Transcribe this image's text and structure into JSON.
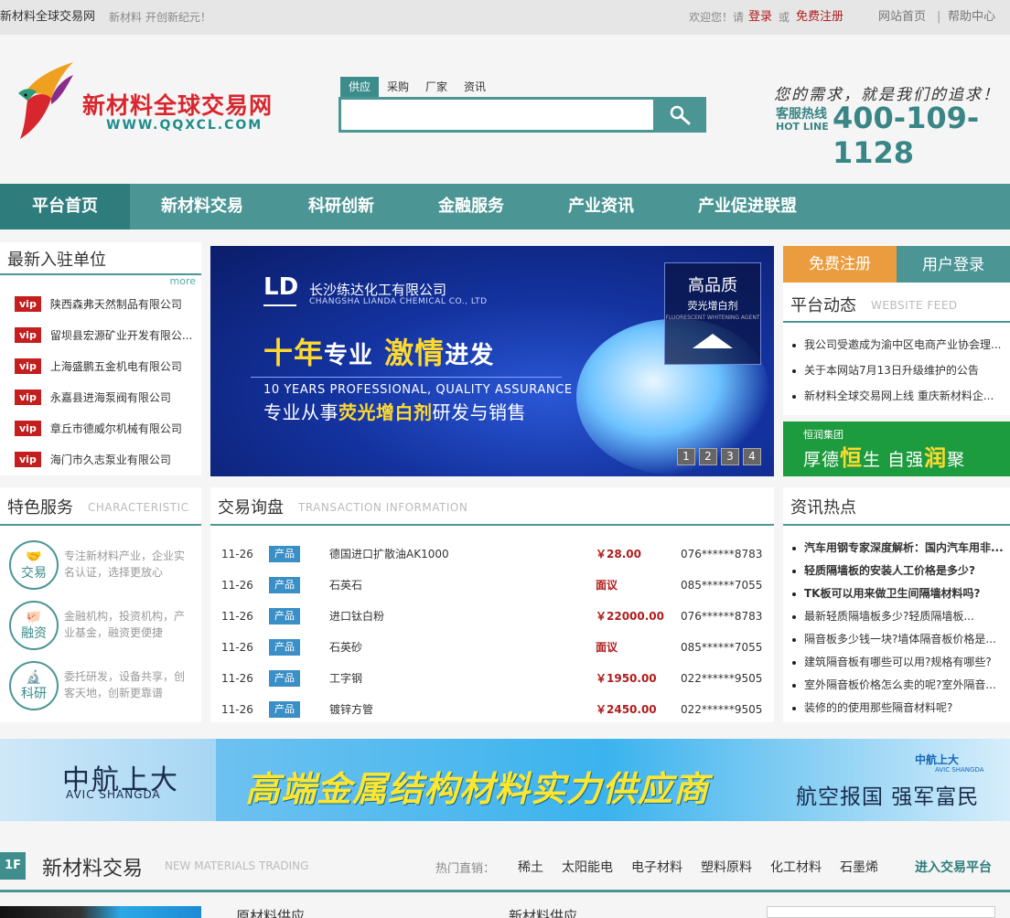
{
  "topbar": {
    "site_name": "新材料全球交易网",
    "slogan": "新材料 开创新纪元！",
    "welcome": "欢迎您！请",
    "login": "登录",
    "or": "或",
    "register": "免费注册",
    "home": "网站首页",
    "separator": "|",
    "help": "帮助中心"
  },
  "logo": {
    "title": "新材料全球交易网",
    "url": "WWW.QQXCL.COM"
  },
  "search": {
    "tabs": [
      "供应",
      "采购",
      "厂家",
      "资讯"
    ],
    "active_tab": 0,
    "placeholder": "",
    "button_icon": "search-icon"
  },
  "hotline": {
    "slogan": "您的需求，就是我们的追求！",
    "label_cn": "客服热线",
    "label_en": "HOT LINE",
    "number": "400-109-1128"
  },
  "nav": {
    "items": [
      "平台首页",
      "新材料交易",
      "科研创新",
      "金融服务",
      "产业资讯",
      "产业促进联盟"
    ],
    "active": 0
  },
  "members": {
    "title": "最新入驻单位",
    "more": "more",
    "badge": "vip",
    "items": [
      "陕西森弗天然制品有限公司",
      "留坝县宏源矿业开发有限公...",
      "上海盛鹏五金机电有限公司",
      "永嘉县进海泵阀有限公司",
      "章丘市德威尔机械有限公司",
      "海门市久志泵业有限公司"
    ]
  },
  "banner": {
    "logo_mark": "LD",
    "company": "长沙练达化工有限公司",
    "company_en": "CHANGSHA LIANDA CHEMICAL CO., LTD",
    "slogan_part1": "十年",
    "slogan_part2": "专业",
    "slogan_part3": "激情",
    "slogan_part4": "进发",
    "english": "10 YEARS PROFESSIONAL, QUALITY ASSURANCE",
    "desc_pre": "专业从事",
    "desc_bold": "荧光增白剂",
    "desc_post": "研发与销售",
    "badge_title": "高品质",
    "badge_sub": "荧光增白剂",
    "badge_en": "FLUORESCENT WHITENING AGENT",
    "pages": [
      "1",
      "2",
      "3",
      "4"
    ]
  },
  "account": {
    "register": "免费注册",
    "login": "用户登录"
  },
  "feed": {
    "title": "平台动态",
    "subtitle": "WEBSITE FEED",
    "items": [
      "我公司受邀成为渝中区电商产业协会理...",
      "关于本网站7月13日升级维护的公告",
      "新材料全球交易网上线 重庆新材料企..."
    ]
  },
  "ad_green": {
    "company": "恒润集团",
    "text_a": "厚德",
    "text_b": "恒",
    "text_c": "生  自强",
    "text_d": "润",
    "text_e": "聚"
  },
  "characteristic": {
    "title": "特色服务",
    "subtitle": "CHARACTERISTIC",
    "items": [
      {
        "icon": "handshake-icon",
        "label": "交易",
        "text": "专注新材料产业，企业实名认证，选择更放心"
      },
      {
        "icon": "piggy-bank-icon",
        "label": "融资",
        "text": "金融机构，投资机构，产业基金，融资更便捷"
      },
      {
        "icon": "microscope-icon",
        "label": "科研",
        "text": "委托研发，设备共享，创客天地，创新更靠谱"
      }
    ]
  },
  "transaction": {
    "title": "交易询盘",
    "subtitle": "TRANSACTION INFORMATION",
    "rows": [
      {
        "date": "11-26",
        "type": "产品",
        "name": "德国进口扩散油AK1000",
        "price": "￥28.00",
        "phone": "076******8783"
      },
      {
        "date": "11-26",
        "type": "产品",
        "name": "石英石",
        "price": "面议",
        "phone": "085******7055"
      },
      {
        "date": "11-26",
        "type": "产品",
        "name": "进口钛白粉",
        "price": "￥22000.00",
        "phone": "076******8783"
      },
      {
        "date": "11-26",
        "type": "产品",
        "name": "石英砂",
        "price": "面议",
        "phone": "085******7055"
      },
      {
        "date": "11-26",
        "type": "产品",
        "name": "工字钢",
        "price": "￥1950.00",
        "phone": "022******9505"
      },
      {
        "date": "11-26",
        "type": "产品",
        "name": "镀锌方管",
        "price": "￥2450.00",
        "phone": "022******9505"
      }
    ]
  },
  "hot": {
    "title": "资讯热点",
    "items": [
      {
        "text": "汽车用钢专家深度解析：国内汽车用非...",
        "bold": true
      },
      {
        "text": "轻质隔墙板的安装人工价格是多少?",
        "bold": true
      },
      {
        "text": "TK板可以用来做卫生间隔墙材料吗?",
        "bold": true
      },
      {
        "text": "最新轻质隔墙板多少?轻质隔墙板...",
        "bold": false
      },
      {
        "text": "隔音板多少钱一块?墙体隔音板价格是...",
        "bold": false
      },
      {
        "text": "建筑隔音板有哪些可以用?规格有哪些?",
        "bold": false
      },
      {
        "text": "室外隔音板价格怎么卖的呢?室外隔音...",
        "bold": false
      },
      {
        "text": "装修的的使用那些隔音材料呢?",
        "bold": false
      }
    ]
  },
  "big_ad": {
    "brand_cn": "中航上大",
    "brand_en": "AVIC SHANGDA",
    "slogan": "高端金属结构材料实力供应商",
    "logo_small": "中航上大",
    "logo_small_en": "AVIC SHANGDA",
    "right_text": "航空报国  强军富民"
  },
  "floor": {
    "badge": "1F",
    "title": "新材料交易",
    "subtitle": "NEW MATERIALS TRADING",
    "hot_label": "热门直销：",
    "links": [
      "稀土",
      "太阳能电",
      "电子材料",
      "塑料原料",
      "化工材料",
      "石墨烯"
    ],
    "enter": "进入交易平台"
  },
  "bottom": {
    "col1": "原材料供应",
    "col2": "新材料供应"
  },
  "colors": {
    "teal": "#4b9595",
    "red": "#b01c1c",
    "orange": "#eb9c3e",
    "green": "#1d9b3f"
  }
}
